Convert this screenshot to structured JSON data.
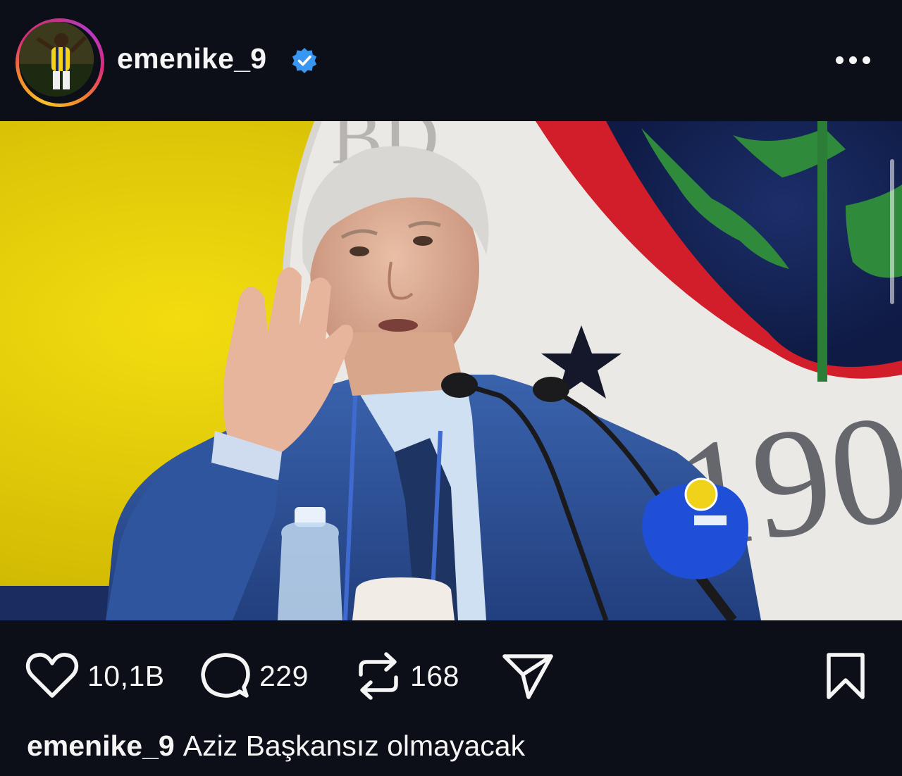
{
  "post": {
    "username": "emenike_9",
    "verified": true,
    "avatar_icon": "profile-photo",
    "more_icon": "more-horizontal-icon"
  },
  "actions": {
    "likes": "10,1B",
    "comments": "229",
    "reposts": "168",
    "like_icon": "heart-icon",
    "comment_icon": "comment-bubble-icon",
    "repost_icon": "repost-arrows-icon",
    "share_icon": "send-paper-plane-icon",
    "save_icon": "bookmark-icon"
  },
  "caption": {
    "username": "emenike_9",
    "text": "Aziz Başkansız olmayacak"
  },
  "colors": {
    "background": "#0c0f17",
    "text": "#f5f5f5",
    "verified_badge": "#3897f0",
    "flag_yellow": "#e9d200",
    "jacket_blue": "#2b4f93"
  }
}
